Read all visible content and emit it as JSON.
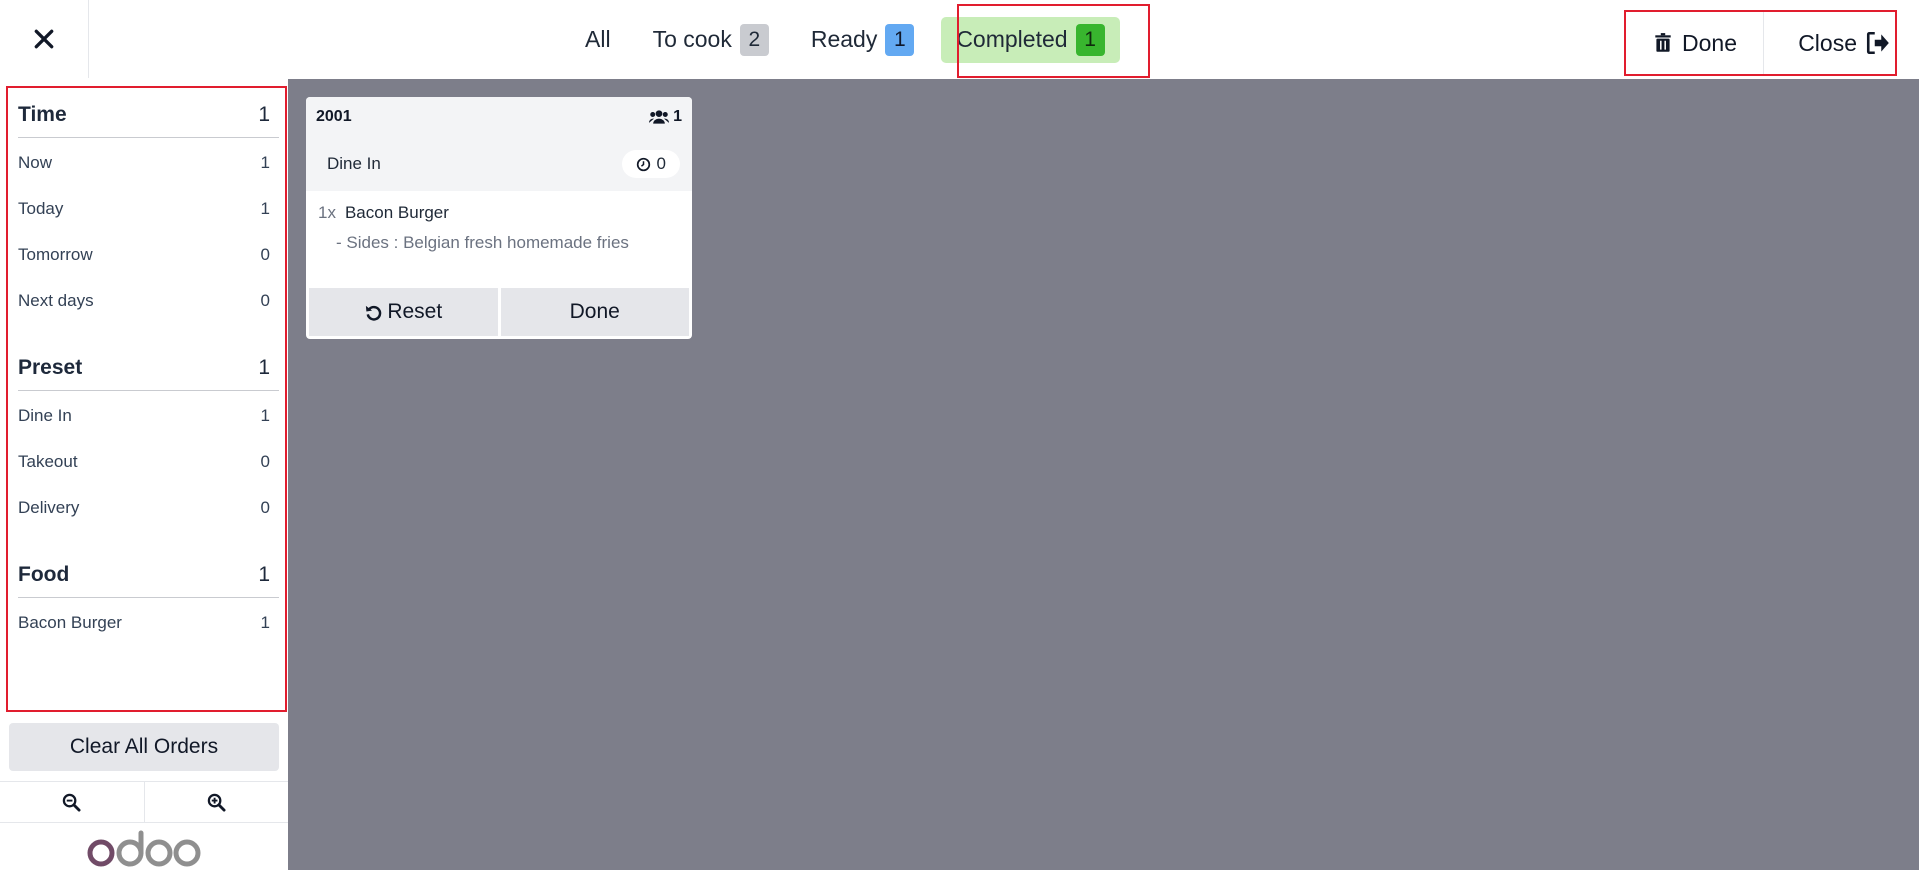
{
  "header": {
    "close_icon": "close-icon",
    "tabs": [
      {
        "label": "All",
        "count": ""
      },
      {
        "label": "To cook",
        "count": "2"
      },
      {
        "label": "Ready",
        "count": "1"
      },
      {
        "label": "Completed",
        "count": "1"
      }
    ],
    "done_label": "Done",
    "done_icon": "trash-icon",
    "close_label": "Close",
    "close_icon2": "sign-out-icon"
  },
  "sidebar": {
    "groups": [
      {
        "title": "Time",
        "count": "1",
        "items": [
          {
            "label": "Now",
            "count": "1"
          },
          {
            "label": "Today",
            "count": "1"
          },
          {
            "label": "Tomorrow",
            "count": "0"
          },
          {
            "label": "Next days",
            "count": "0"
          }
        ]
      },
      {
        "title": "Preset",
        "count": "1",
        "items": [
          {
            "label": "Dine In",
            "count": "1"
          },
          {
            "label": "Takeout",
            "count": "0"
          },
          {
            "label": "Delivery",
            "count": "0"
          }
        ]
      },
      {
        "title": "Food",
        "count": "1",
        "items": [
          {
            "label": "Bacon Burger",
            "count": "1"
          }
        ]
      }
    ],
    "clear_label": "Clear All Orders",
    "zoom_out_icon": "zoom-out-icon",
    "zoom_in_icon": "zoom-in-icon",
    "logo_text": "odoo"
  },
  "order": {
    "number": "2001",
    "guests": "1",
    "preset": "Dine In",
    "timer": "0",
    "lines": [
      {
        "qty": "1x",
        "product": "Bacon Burger",
        "note": "- Sides : Belgian fresh homemade fries"
      }
    ],
    "reset_label": "Reset",
    "done_label": "Done"
  },
  "colors": {
    "accent_frame": "#e11d2e",
    "completed_bg": "#c8edb8",
    "completed_badge": "#38b52e",
    "ready_badge": "#63a9f2",
    "main_bg": "#7d7e8a"
  }
}
